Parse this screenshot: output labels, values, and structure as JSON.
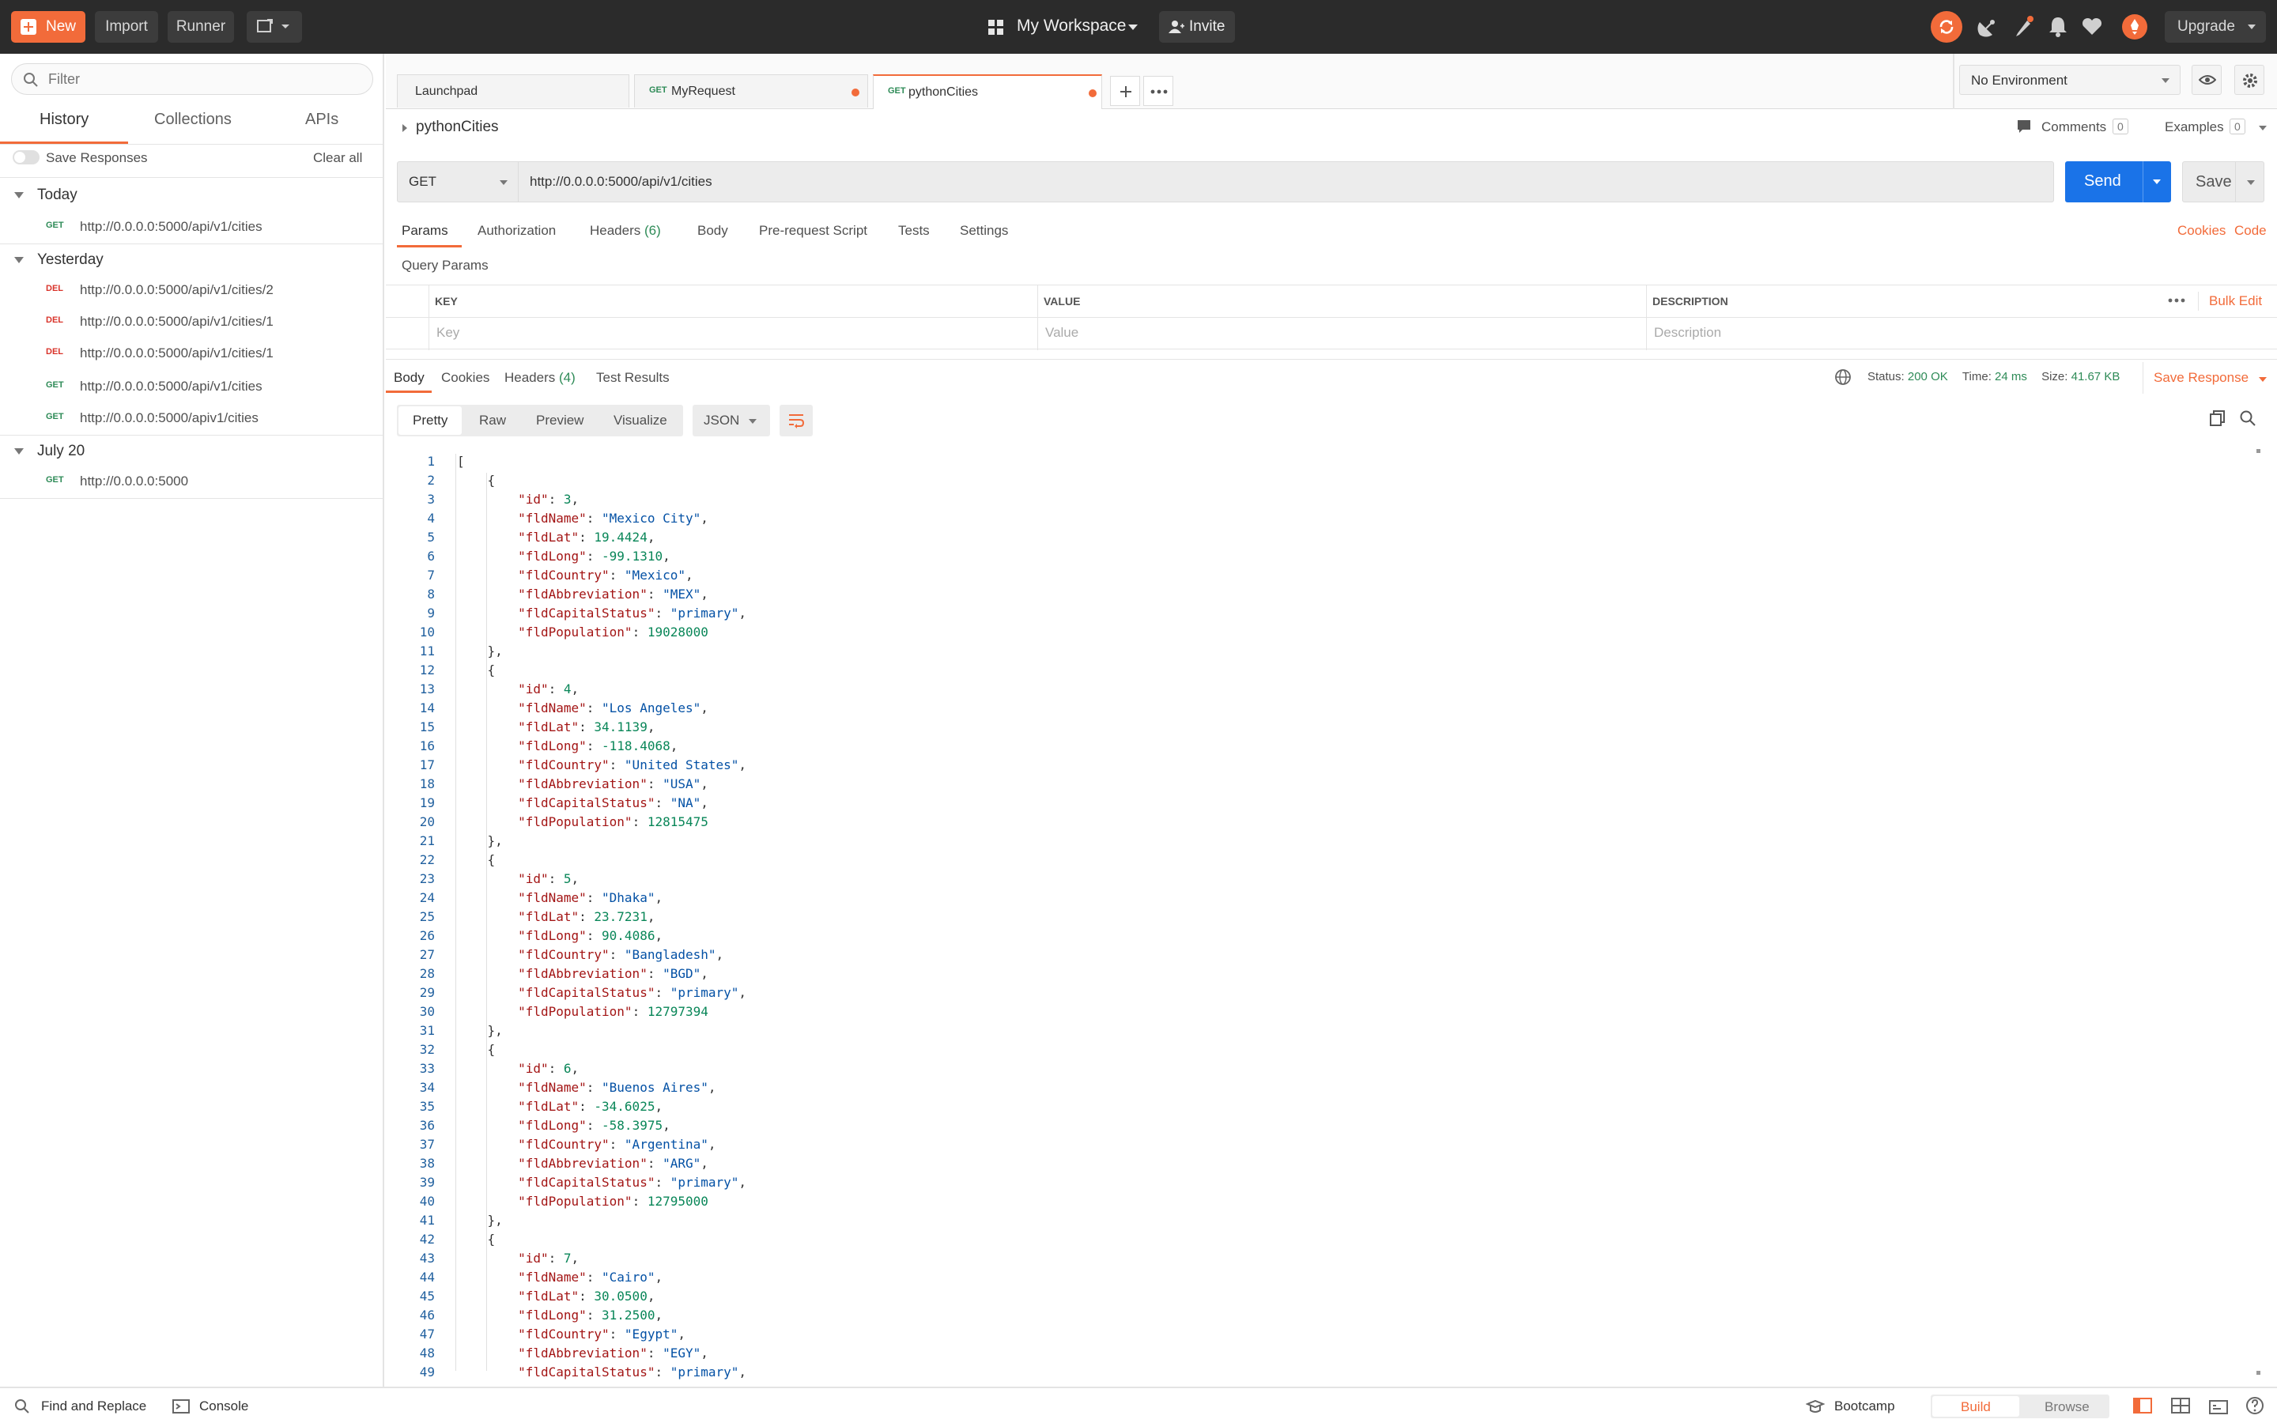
{
  "colors": {
    "accent": "#f26b3a",
    "send": "#1a73e8",
    "get": "#2e8b57",
    "del": "#d9342b",
    "topbar": "#2b2b2b"
  },
  "topbar": {
    "new_label": "New",
    "import_label": "Import",
    "runner_label": "Runner",
    "workspace_label": "My Workspace",
    "invite_label": "Invite",
    "upgrade_label": "Upgrade"
  },
  "sidebar": {
    "filter_placeholder": "Filter",
    "tabs": [
      "History",
      "Collections",
      "APIs"
    ],
    "save_responses_label": "Save Responses",
    "clear_all_label": "Clear all",
    "groups": [
      {
        "label": "Today",
        "items": [
          {
            "method": "GET",
            "url": "http://0.0.0.0:5000/api/v1/cities"
          }
        ]
      },
      {
        "label": "Yesterday",
        "items": [
          {
            "method": "DEL",
            "url": "http://0.0.0.0:5000/api/v1/cities/2"
          },
          {
            "method": "DEL",
            "url": "http://0.0.0.0:5000/api/v1/cities/1"
          },
          {
            "method": "DEL",
            "url": "http://0.0.0.0:5000/api/v1/cities/1"
          },
          {
            "method": "GET",
            "url": "http://0.0.0.0:5000/api/v1/cities"
          },
          {
            "method": "GET",
            "url": "http://0.0.0.0:5000/apiv1/cities"
          }
        ]
      },
      {
        "label": "July 20",
        "items": [
          {
            "method": "GET",
            "url": "http://0.0.0.0:5000"
          }
        ]
      }
    ]
  },
  "tabs": [
    {
      "method": "",
      "label": "Launchpad"
    },
    {
      "method": "GET",
      "label": "MyRequest"
    },
    {
      "method": "GET",
      "label": "pythonCities"
    }
  ],
  "environment": {
    "selected": "No Environment"
  },
  "request": {
    "name": "pythonCities",
    "comments_label": "Comments",
    "comments_count": "0",
    "examples_label": "Examples",
    "examples_count": "0",
    "method": "GET",
    "url": "http://0.0.0.0:5000/api/v1/cities",
    "send_label": "Send",
    "save_label": "Save",
    "subtabs": {
      "params": "Params",
      "authorization": "Authorization",
      "headers": "Headers",
      "headers_count": "(6)",
      "body": "Body",
      "prerequest": "Pre-request Script",
      "tests": "Tests",
      "settings": "Settings"
    },
    "cookies_link": "Cookies",
    "code_link": "Code",
    "query_params_title": "Query Params",
    "table": {
      "col_key": "KEY",
      "col_value": "VALUE",
      "col_desc": "DESCRIPTION",
      "bulk_edit": "Bulk Edit",
      "ph_key": "Key",
      "ph_value": "Value",
      "ph_desc": "Description"
    }
  },
  "response": {
    "tabs": {
      "body": "Body",
      "cookies": "Cookies",
      "headers": "Headers",
      "headers_count": "(4)",
      "tests": "Test Results"
    },
    "status_label": "Status:",
    "status_value": "200 OK",
    "time_label": "Time:",
    "time_value": "24 ms",
    "size_label": "Size:",
    "size_value": "41.67 KB",
    "save_response_label": "Save Response",
    "views": {
      "pretty": "Pretty",
      "raw": "Raw",
      "preview": "Preview",
      "visualize": "Visualize"
    },
    "format": "JSON",
    "code_lines": [
      "[",
      "    {",
      "        \"id\": 3,",
      "        \"fldName\": \"Mexico City\",",
      "        \"fldLat\": 19.4424,",
      "        \"fldLong\": -99.1310,",
      "        \"fldCountry\": \"Mexico\",",
      "        \"fldAbbreviation\": \"MEX\",",
      "        \"fldCapitalStatus\": \"primary\",",
      "        \"fldPopulation\": 19028000",
      "    },",
      "    {",
      "        \"id\": 4,",
      "        \"fldName\": \"Los Angeles\",",
      "        \"fldLat\": 34.1139,",
      "        \"fldLong\": -118.4068,",
      "        \"fldCountry\": \"United States\",",
      "        \"fldAbbreviation\": \"USA\",",
      "        \"fldCapitalStatus\": \"NA\",",
      "        \"fldPopulation\": 12815475",
      "    },",
      "    {",
      "        \"id\": 5,",
      "        \"fldName\": \"Dhaka\",",
      "        \"fldLat\": 23.7231,",
      "        \"fldLong\": 90.4086,",
      "        \"fldCountry\": \"Bangladesh\",",
      "        \"fldAbbreviation\": \"BGD\",",
      "        \"fldCapitalStatus\": \"primary\",",
      "        \"fldPopulation\": 12797394",
      "    },",
      "    {",
      "        \"id\": 6,",
      "        \"fldName\": \"Buenos Aires\",",
      "        \"fldLat\": -34.6025,",
      "        \"fldLong\": -58.3975,",
      "        \"fldCountry\": \"Argentina\",",
      "        \"fldAbbreviation\": \"ARG\",",
      "        \"fldCapitalStatus\": \"primary\",",
      "        \"fldPopulation\": 12795000",
      "    },",
      "    {",
      "        \"id\": 7,",
      "        \"fldName\": \"Cairo\",",
      "        \"fldLat\": 30.0500,",
      "        \"fldLong\": 31.2500,",
      "        \"fldCountry\": \"Egypt\",",
      "        \"fldAbbreviation\": \"EGY\",",
      "        \"fldCapitalStatus\": \"primary\","
    ]
  },
  "bottombar": {
    "find_replace": "Find and Replace",
    "console": "Console",
    "bootcamp": "Bootcamp",
    "build": "Build",
    "browse": "Browse"
  },
  "icons": [
    "new-icon",
    "builder-icon",
    "workspace-grid-icon",
    "invite-icon",
    "sync-icon",
    "satellite-icon",
    "pen-icon",
    "bell-icon",
    "heart-icon",
    "avatar-icon",
    "eye-icon",
    "gear-icon",
    "search-icon",
    "globe-icon",
    "wrap-icon",
    "copy-icon",
    "console-icon",
    "bootcamp-icon",
    "layout-icon",
    "help-icon"
  ]
}
